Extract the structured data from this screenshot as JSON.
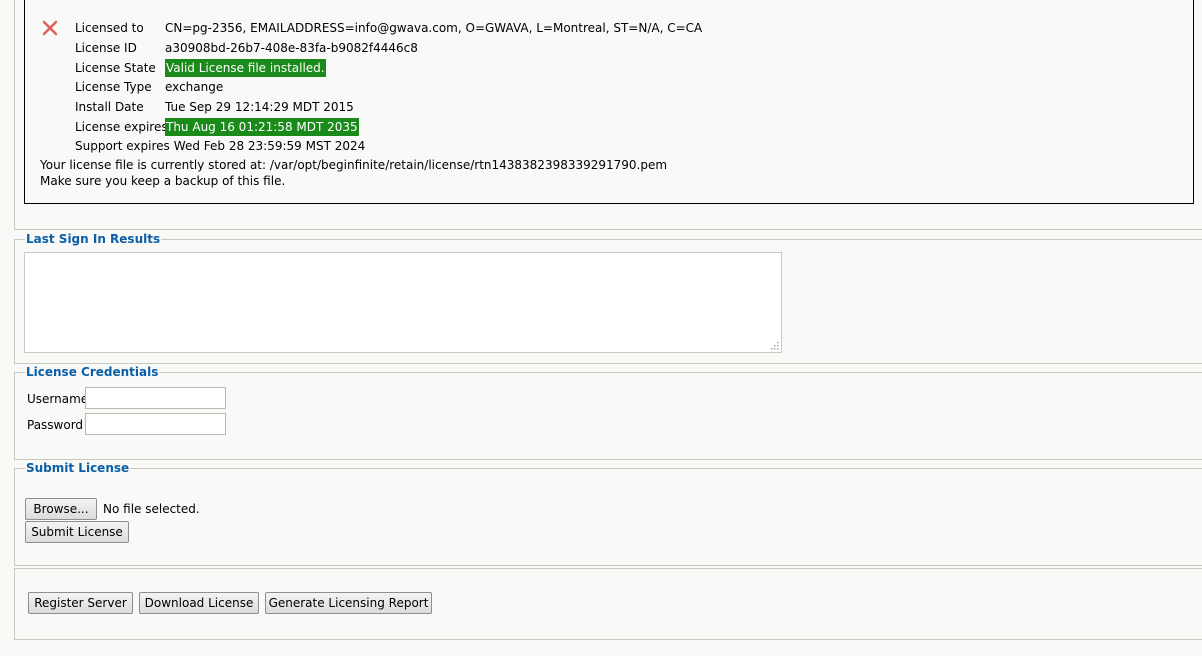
{
  "license": {
    "status_icon": "close-icon",
    "rows": [
      {
        "label": "Licensed to",
        "value": "CN=pg-2356, EMAILADDRESS=info@gwava.com, O=GWAVA, L=Montreal, ST=N/A, C=CA",
        "highlight": false
      },
      {
        "label": "License ID",
        "value": "a30908bd-26b7-408e-83fa-b9082f4446c8",
        "highlight": false
      },
      {
        "label": "License State",
        "value": "Valid License file installed.",
        "highlight": true
      },
      {
        "label": "License Type",
        "value": "exchange",
        "highlight": false
      },
      {
        "label": "Install Date",
        "value": "Tue Sep 29 12:14:29 MDT 2015",
        "highlight": false
      },
      {
        "label": "License expires",
        "value": "Thu Aug 16 01:21:58 MDT 2035",
        "highlight": true
      },
      {
        "label": "Support expires",
        "value": "Wed Feb 28 23:59:59 MST 2024",
        "highlight": false
      }
    ],
    "stored_note": "Your license file is currently stored at: /var/opt/beginfinite/retain/license/rtn1438382398339291790.pem",
    "backup_note": "Make sure you keep a backup of this file.",
    "highlight_color": "#1a8a1a"
  },
  "last_sign_in": {
    "legend": "Last Sign In Results",
    "results": ""
  },
  "credentials": {
    "legend": "License Credentials",
    "username_label": "Username",
    "username_value": "",
    "password_label": "Password",
    "password_value": ""
  },
  "submit": {
    "legend": "Submit License",
    "browse_label": "Browse...",
    "file_status": "No file selected.",
    "submit_label": "Submit License"
  },
  "actions": {
    "register_label": "Register Server",
    "download_label": "Download License",
    "report_label": "Generate Licensing Report"
  },
  "colors": {
    "legend": "#0b5ea8",
    "close_icon": "#e0605a"
  }
}
